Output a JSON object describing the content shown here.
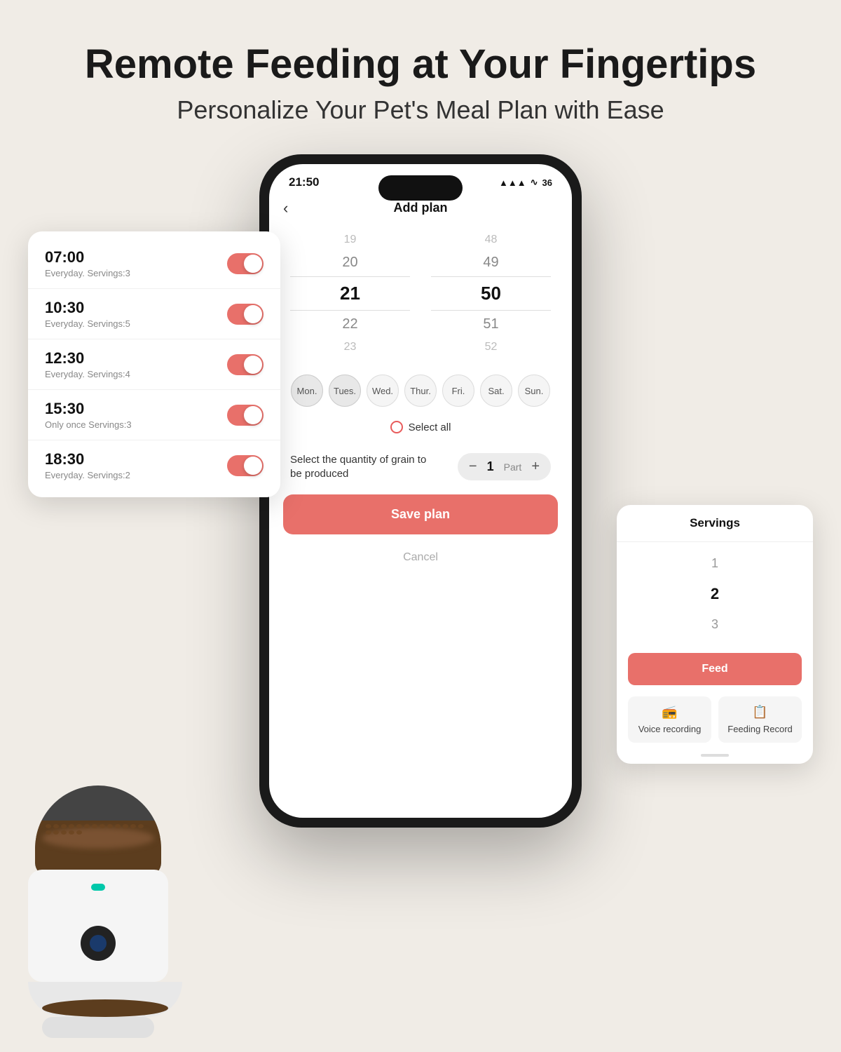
{
  "header": {
    "title": "Remote Feeding at Your Fingertips",
    "subtitle": "Personalize Your Pet's Meal Plan with Ease"
  },
  "status_bar": {
    "time": "21:50",
    "signal": "▲▲▲",
    "wifi": "WiFi",
    "battery": "36"
  },
  "phone": {
    "nav_back": "‹",
    "nav_title": "Add plan"
  },
  "time_picker": {
    "hours": [
      {
        "value": "19",
        "state": "far"
      },
      {
        "value": "20",
        "state": "near"
      },
      {
        "value": "21",
        "state": "selected"
      },
      {
        "value": "22",
        "state": "near"
      },
      {
        "value": "23",
        "state": "far"
      }
    ],
    "minutes": [
      {
        "value": "48",
        "state": "far"
      },
      {
        "value": "49",
        "state": "near"
      },
      {
        "value": "50",
        "state": "selected"
      },
      {
        "value": "51",
        "state": "near"
      },
      {
        "value": "52",
        "state": "far"
      }
    ]
  },
  "days": [
    {
      "label": "Mon.",
      "active": true
    },
    {
      "label": "Tues.",
      "active": true
    },
    {
      "label": "Wed.",
      "active": false
    },
    {
      "label": "Thur.",
      "active": false
    },
    {
      "label": "Fri.",
      "active": false
    },
    {
      "label": "Sat.",
      "active": false
    },
    {
      "label": "Sun.",
      "active": false
    }
  ],
  "select_all": "Select all",
  "grain": {
    "label": "Select the quantity of grain to be produced",
    "value": "1",
    "unit": "Part",
    "minus": "−",
    "plus": "+"
  },
  "buttons": {
    "save_plan": "Save plan",
    "cancel": "Cancel"
  },
  "plan_list": [
    {
      "time": "07:00",
      "frequency": "Everyday.",
      "servings": "Servings:3"
    },
    {
      "time": "10:30",
      "frequency": "Everyday.",
      "servings": "Servings:5"
    },
    {
      "time": "12:30",
      "frequency": "Everyday.",
      "servings": "Servings:4"
    },
    {
      "time": "15:30",
      "frequency": "Only once",
      "servings": "Servings:3"
    },
    {
      "time": "18:30",
      "frequency": "Everyday.",
      "servings": "Servings:2"
    }
  ],
  "servings_panel": {
    "title": "Servings",
    "items": [
      "1",
      "2",
      "3"
    ],
    "selected_index": 0,
    "feed_label": "Feed",
    "voice_recording": "Voice recording",
    "feeding_record": "Feeding Record"
  }
}
